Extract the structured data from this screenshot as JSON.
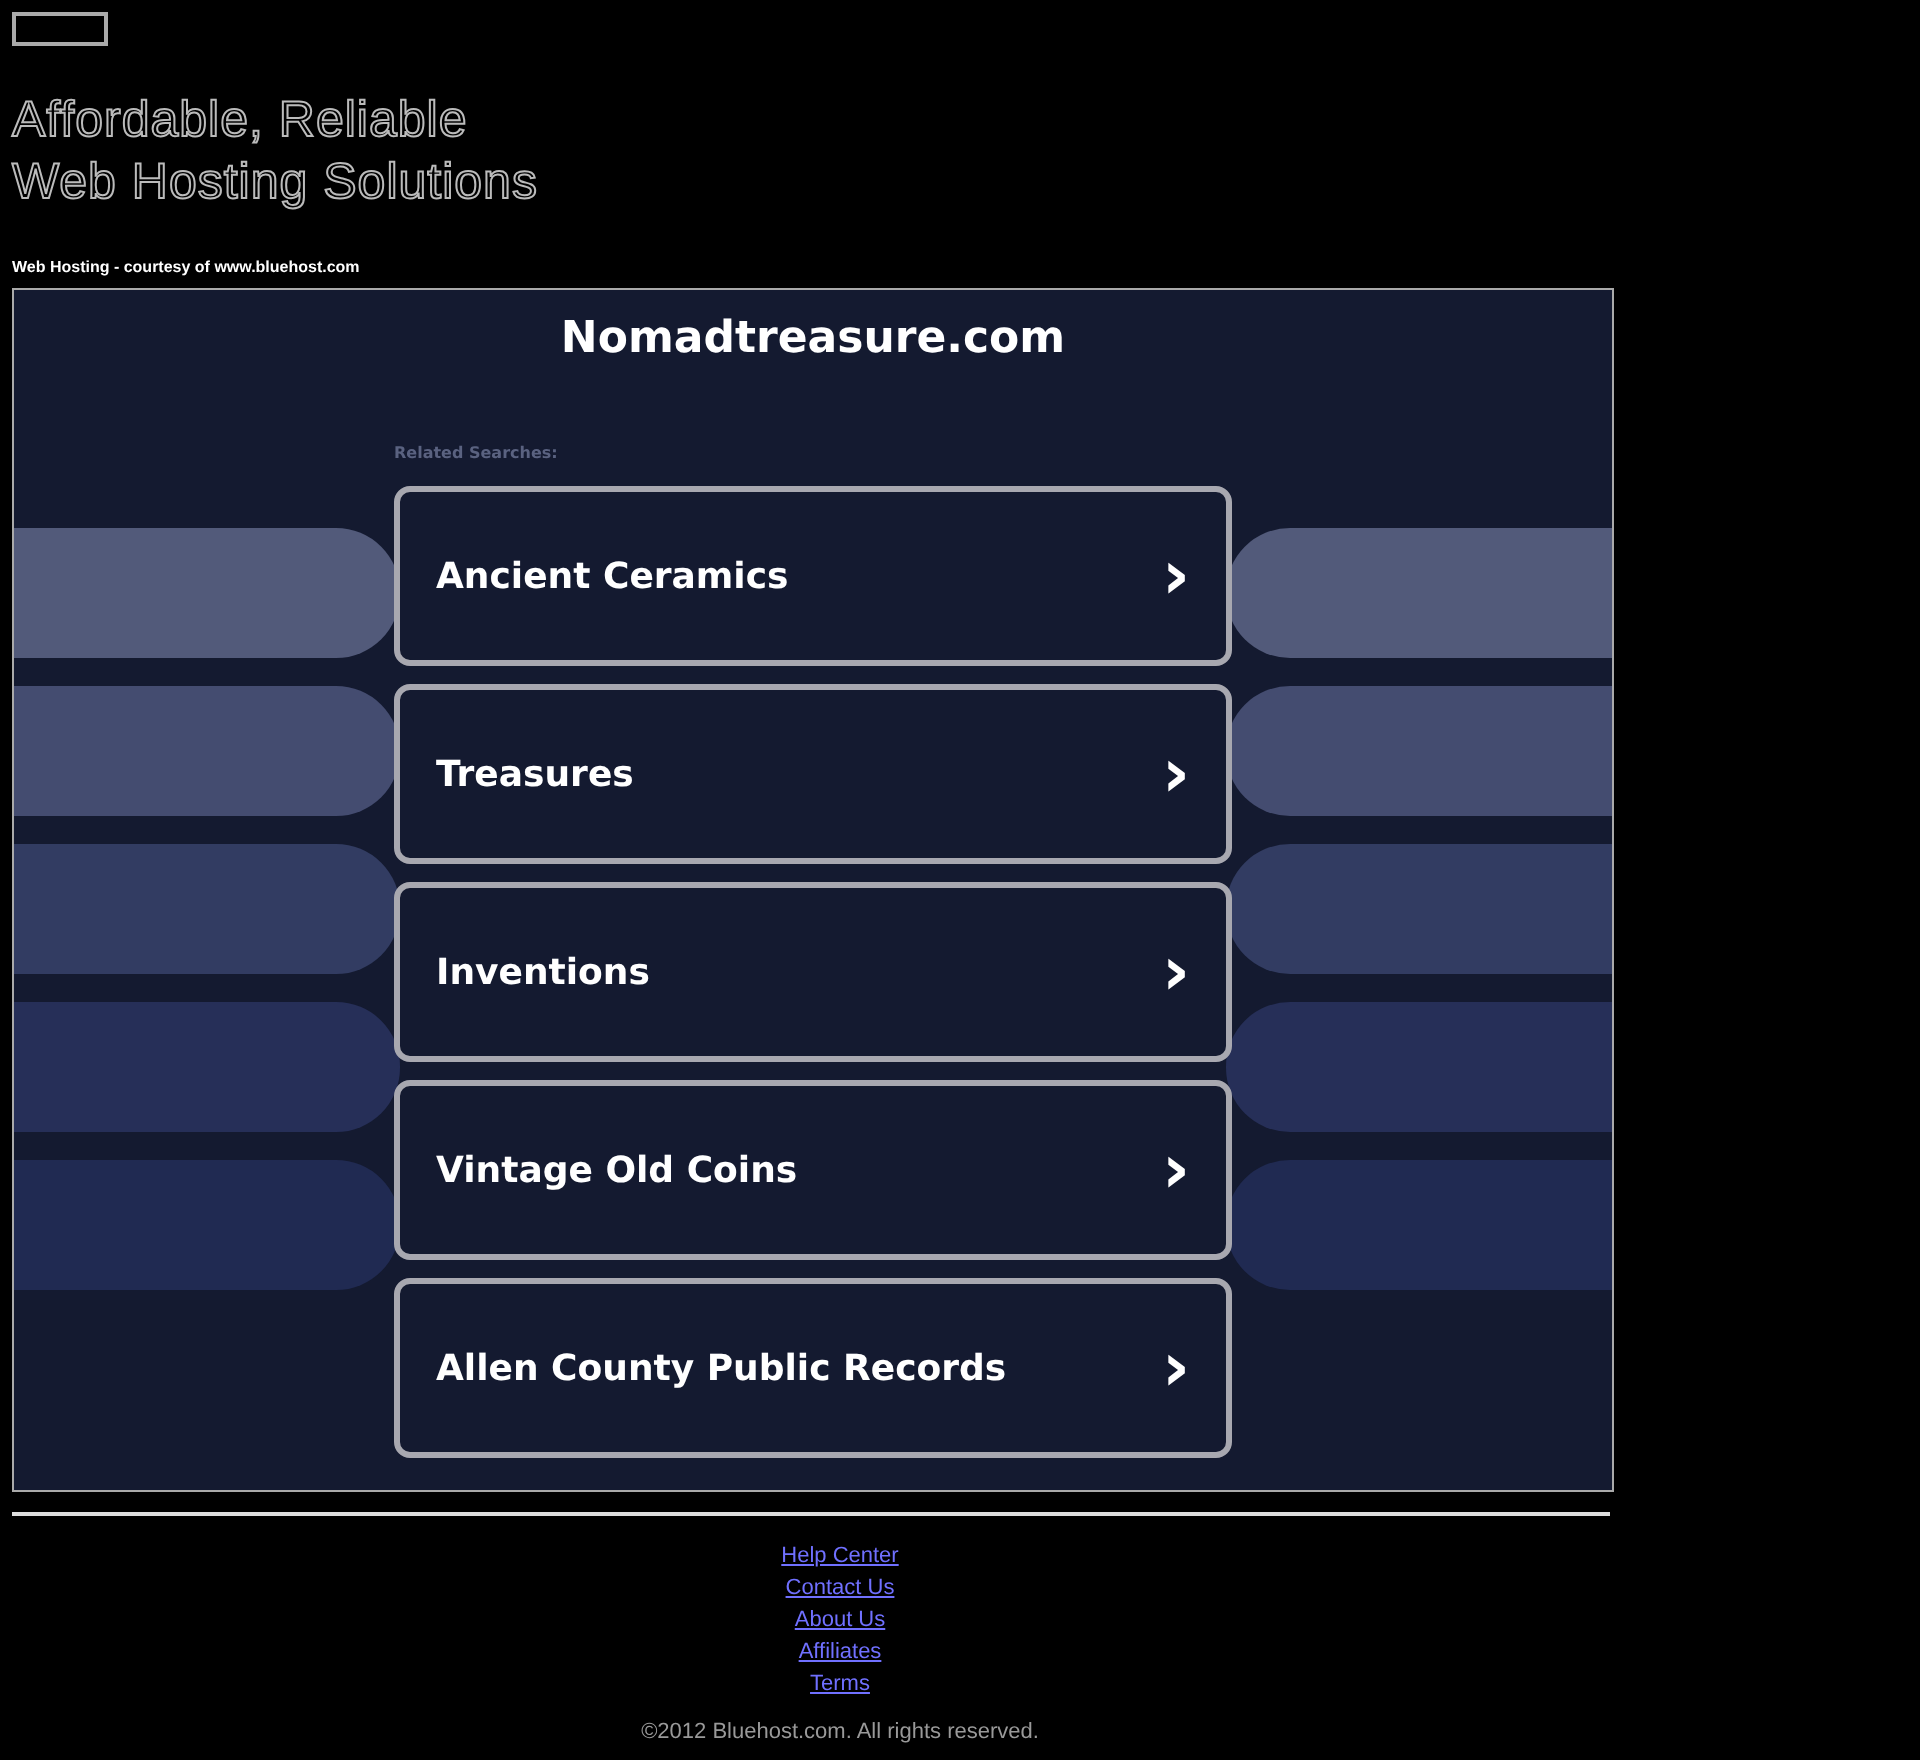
{
  "header": {
    "headline_lines": [
      "Affordable, Reliable",
      "Web Hosting Solutions"
    ],
    "courtesy": "Web Hosting - courtesy of www.bluehost.com"
  },
  "parked_frame": {
    "domain": "Nomadtreasure.com",
    "related_label": "Related Searches:",
    "links": [
      {
        "label": "Ancient Ceramics",
        "icon": "›"
      },
      {
        "label": "Treasures",
        "icon": "›"
      },
      {
        "label": "Inventions",
        "icon": "›"
      },
      {
        "label": "Vintage Old Coins",
        "icon": "›"
      },
      {
        "label": "Allen County Public Records",
        "icon": "›"
      }
    ]
  },
  "footer": {
    "links": [
      "Help Center",
      "Contact Us",
      "About Us",
      "Affiliates",
      "Terms"
    ],
    "copyright": "©2012 Bluehost.com. All rights reserved."
  }
}
